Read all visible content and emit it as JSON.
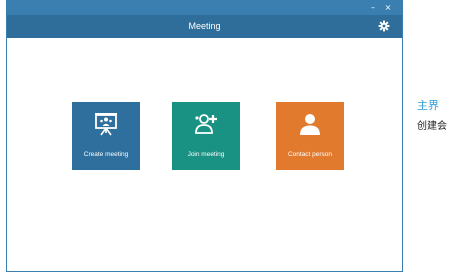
{
  "window": {
    "minimize_glyph": "–",
    "close_glyph": "×",
    "title": "Meeting",
    "settings_icon": "gear-icon"
  },
  "tiles": [
    {
      "label": "Create meeting",
      "icon": "presentation-board-icon",
      "color": "#2e6f9d"
    },
    {
      "label": "Join meeting",
      "icon": "add-person-icon",
      "color": "#1a9283"
    },
    {
      "label": "Contact person",
      "icon": "person-icon",
      "color": "#e27a2e"
    }
  ],
  "side_text": {
    "title": "主界",
    "subtitle": "创建会"
  },
  "colors": {
    "header": "#2f6d9b",
    "title_strip": "#3b7fb1",
    "accent_text": "#2ea0d8"
  }
}
